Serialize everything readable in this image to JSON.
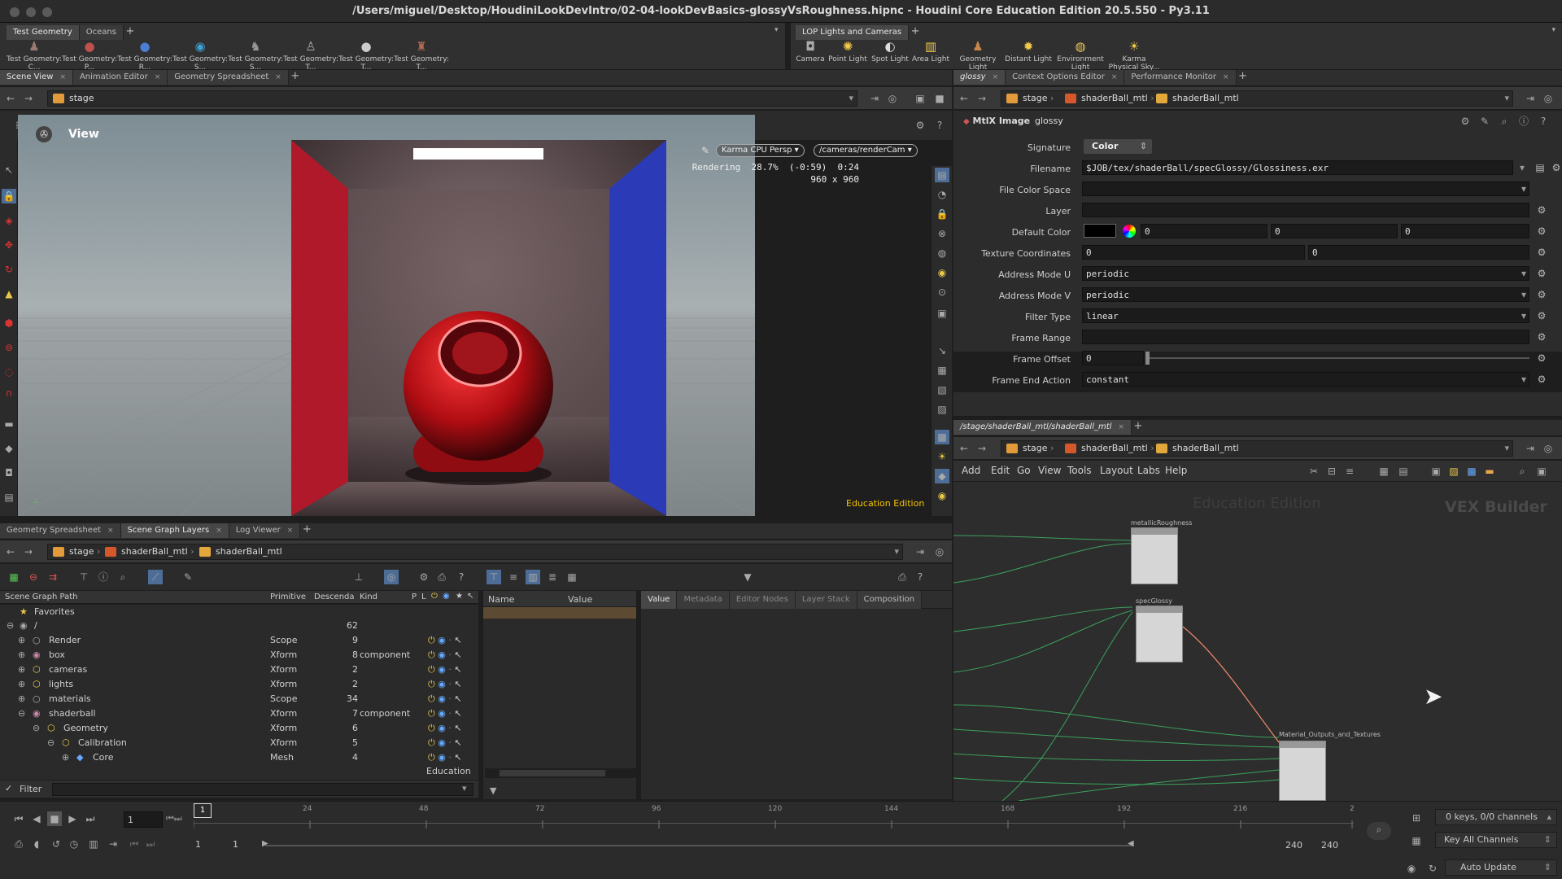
{
  "window": {
    "title": "/Users/miguel/Desktop/HoudiniLookDevIntro/02-04-lookDevBasics-glossyVsRoughness.hipnc - Houdini Core Education Edition 20.5.550 - Py3.11"
  },
  "shelf_left": {
    "tabs": [
      "Test Geometry",
      "Oceans"
    ],
    "tools": [
      "Test Geometry: C...",
      "Test Geometry: P...",
      "Test Geometry: R...",
      "Test Geometry: S...",
      "Test Geometry: S...",
      "Test Geometry: T...",
      "Test Geometry: T...",
      "Test Geometry: T..."
    ]
  },
  "shelf_right": {
    "tabs": [
      "LOP Lights and Cameras"
    ],
    "tools": [
      "Camera",
      "Point Light",
      "Spot Light",
      "Area Light",
      "Geometry Light",
      "Distant Light",
      "Environment Light",
      "Karma Physical Sky..."
    ]
  },
  "scene_pane": {
    "tabs": [
      "Scene View",
      "Animation Editor",
      "Geometry Spreadsheet"
    ],
    "path": "stage",
    "view_label": "View",
    "renderer": "Karma CPU Persp",
    "camera": "/cameras/renderCam",
    "render_status": "Rendering  28.7%  (-0:59)  0:24",
    "render_res": "960 x 960",
    "watermark": "Education Edition"
  },
  "param_pane": {
    "tabs": [
      "glossy",
      "Context Options Editor",
      "Performance Monitor"
    ],
    "path": [
      "stage",
      "shaderBall_mtl",
      "shaderBall_mtl"
    ],
    "node_type": "MtlX Image",
    "node_name": "glossy",
    "params": {
      "signature_label": "Signature",
      "signature_value": "Color",
      "filename_label": "Filename",
      "filename_value": "$JOB/tex/shaderBall/specGlossy/Glossiness.exr",
      "colorspace_label": "File Color Space",
      "layer_label": "Layer",
      "default_color_label": "Default Color",
      "default_color_values": [
        "0",
        "0",
        "0"
      ],
      "texcoord_label": "Texture Coordinates",
      "texcoord_values": [
        "0",
        "0"
      ],
      "addr_u_label": "Address Mode U",
      "addr_u_value": "periodic",
      "addr_v_label": "Address Mode V",
      "addr_v_value": "periodic",
      "filter_label": "Filter Type",
      "filter_value": "linear",
      "frame_range_label": "Frame Range",
      "frame_offset_label": "Frame Offset",
      "frame_offset_value": "0",
      "frame_end_label": "Frame End Action",
      "frame_end_value": "constant"
    }
  },
  "network_pane": {
    "tab": "/stage/shaderBall_mtl/shaderBall_mtl",
    "path": [
      "stage",
      "shaderBall_mtl",
      "shaderBall_mtl"
    ],
    "menu": [
      "Add",
      "Edit",
      "Go",
      "View",
      "Tools",
      "Layout",
      "Labs",
      "Help"
    ],
    "watermark": "Education Edition",
    "context_label": "VEX Builder",
    "nodes": [
      "metallicRoughness",
      "specGlossy",
      "Material_Outputs_and_Textures"
    ]
  },
  "sgt_pane": {
    "tabs": [
      "Geometry Spreadsheet",
      "Scene Graph Layers",
      "Log Viewer"
    ],
    "path": [
      "stage",
      "shaderBall_mtl",
      "shaderBall_mtl"
    ],
    "columns": [
      "Scene Graph Path",
      "Primitive",
      "Descenda",
      "Kind",
      "P",
      "L"
    ],
    "favorites": "Favorites",
    "rows": [
      {
        "name": "/",
        "prim": "",
        "desc": "62",
        "kind": "",
        "indent": 0
      },
      {
        "name": "Render",
        "prim": "Scope",
        "desc": "9",
        "kind": "",
        "indent": 1
      },
      {
        "name": "box",
        "prim": "Xform",
        "desc": "8",
        "kind": "component",
        "indent": 1
      },
      {
        "name": "cameras",
        "prim": "Xform",
        "desc": "2",
        "kind": "",
        "indent": 1
      },
      {
        "name": "lights",
        "prim": "Xform",
        "desc": "2",
        "kind": "",
        "indent": 1
      },
      {
        "name": "materials",
        "prim": "Scope",
        "desc": "34",
        "kind": "",
        "indent": 1
      },
      {
        "name": "shaderball",
        "prim": "Xform",
        "desc": "7",
        "kind": "component",
        "indent": 1
      },
      {
        "name": "Geometry",
        "prim": "Xform",
        "desc": "6",
        "kind": "",
        "indent": 2
      },
      {
        "name": "Calibration",
        "prim": "Xform",
        "desc": "5",
        "kind": "",
        "indent": 3
      },
      {
        "name": "Core",
        "prim": "Mesh",
        "desc": "4",
        "kind": "",
        "indent": 4
      }
    ],
    "edu_label": "Education",
    "filter_label": "Filter",
    "props_columns": [
      "Name",
      "Value"
    ],
    "detail_tabs": [
      "Value",
      "Metadata",
      "Editor Nodes",
      "Layer Stack",
      "Composition"
    ]
  },
  "timeline": {
    "frame": "1",
    "marker": "1",
    "ticks": [
      "24",
      "48",
      "72",
      "96",
      "120",
      "144",
      "168",
      "192",
      "216",
      "2"
    ],
    "range_start": "1",
    "range_start2": "1",
    "range_end": "240",
    "range_end2": "240",
    "keys_label": "0 keys, 0/0 channels",
    "key_all_label": "Key All Channels",
    "auto_update": "Auto Update"
  }
}
